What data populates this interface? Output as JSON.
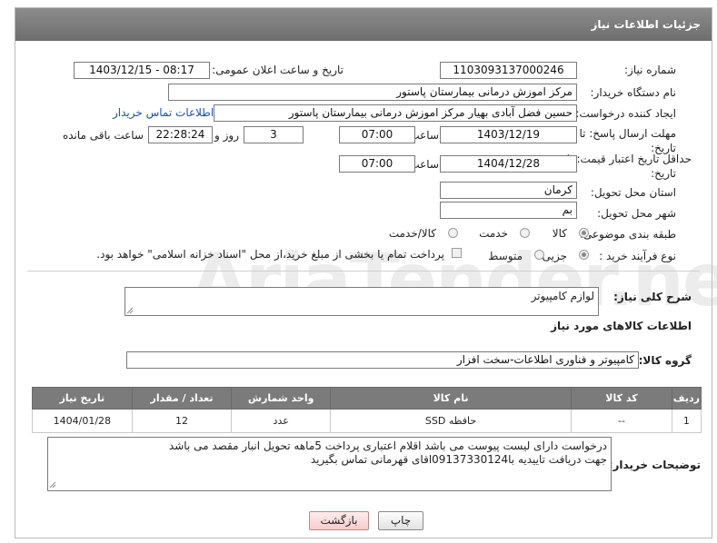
{
  "window": {
    "title": "جزئیات اطلاعات نیاز"
  },
  "fields": {
    "need_number_label": "شماره نیاز:",
    "need_number": "1103093137000246",
    "announce_label": "تاریخ و ساعت اعلان عمومی:",
    "announce_value": "1403/12/15 - 08:17",
    "buyer_org_label": "نام دستگاه خریدار:",
    "buyer_org": "مرکز اموزش درمانی بیمارستان پاستور",
    "requester_label": "ایجاد کننده درخواست:",
    "requester": "حسین فضل آبادی بهیار مرکز اموزش درمانی بیمارستان پاستور",
    "buyer_contact_link": "اطلاعات تماس خریدار",
    "reply_deadline_label_1": "مهلت ارسال پاسخ: تا",
    "reply_deadline_label_2": "تاریخ:",
    "reply_date": "1403/12/19",
    "time_label": "ساعت",
    "reply_time": "07:00",
    "days_count": "3",
    "days_label": "روز و",
    "remaining_time": "22:28:24",
    "remaining_label": "ساعت باقی مانده",
    "price_validity_label_1": "حداقل تاریخ اعتبار قیمت: تا",
    "price_validity_label_2": "تاریخ:",
    "validity_date": "1404/12/28",
    "validity_time": "07:00",
    "province_label": "استان محل تحویل:",
    "province": "کرمان",
    "city_label": "شهر محل تحویل:",
    "city": "بم",
    "category_label": "طبقه بندی موضوعی:",
    "category_options": [
      "کالا",
      "خدمت",
      "کالا/خدمت"
    ],
    "process_label": "نوع فرآیند خرید :",
    "process_options": [
      "جزیی",
      "متوسط"
    ],
    "payment_note": "پرداخت تمام یا بخشی از مبلغ خرید،از محل \"اسناد خزانه اسلامی\" خواهد بود."
  },
  "description": {
    "label": "شرح کلی نیاز:",
    "value": "لوازم کامپیوتر"
  },
  "goods_section": {
    "title": "اطلاعات کالاهای مورد نیاز",
    "group_label": "گروه کالا:",
    "group_value": "کامپیوتر و فناوری اطلاعات-سخت افزار"
  },
  "table": {
    "headers": [
      "ردیف",
      "کد کالا",
      "نام کالا",
      "واحد شمارش",
      "تعداد / مقدار",
      "تاریخ نیاز"
    ],
    "rows": [
      [
        "1",
        "--",
        "حافظه SSD",
        "عدد",
        "12",
        "1404/01/28"
      ]
    ]
  },
  "buyer_notes": {
    "label": "توضیحات خریدار:",
    "line1": "درخواست دارای لیست پیوست می باشد اقلام اعتباری پرداخت 5ماهه تحویل انبار مقصد می باشد",
    "line2": "جهت دریافت تاییدیه با09137330124اقای قهرمانی تماس بگیرید"
  },
  "buttons": {
    "print": "چاپ",
    "back": "بازگشت"
  },
  "watermark": {
    "text": "AriaTender.neT"
  }
}
